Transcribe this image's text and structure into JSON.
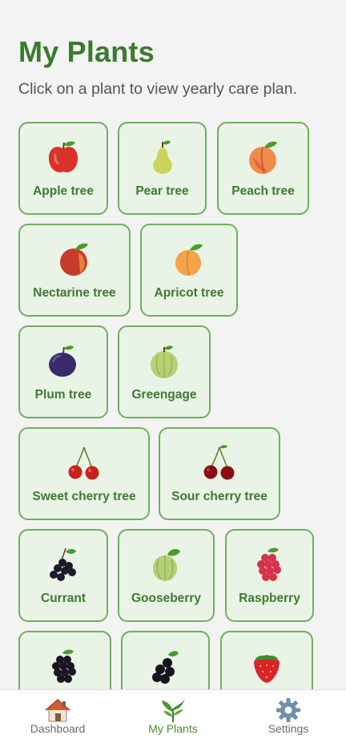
{
  "page": {
    "title": "My Plants",
    "subtitle": "Click on a plant to view yearly care plan."
  },
  "plants": [
    {
      "label": "Apple tree",
      "icon": "apple-icon"
    },
    {
      "label": "Pear tree",
      "icon": "pear-icon"
    },
    {
      "label": "Peach tree",
      "icon": "peach-icon"
    },
    {
      "label": "Nectarine tree",
      "icon": "nectarine-icon"
    },
    {
      "label": "Apricot tree",
      "icon": "apricot-icon"
    },
    {
      "label": "Plum tree",
      "icon": "plum-icon"
    },
    {
      "label": "Greengage",
      "icon": "greengage-icon"
    },
    {
      "label": "Sweet cherry tree",
      "icon": "sweet-cherry-icon"
    },
    {
      "label": "Sour cherry tree",
      "icon": "sour-cherry-icon"
    },
    {
      "label": "Currant",
      "icon": "currant-icon"
    },
    {
      "label": "Gooseberry",
      "icon": "gooseberry-icon"
    },
    {
      "label": "Raspberry",
      "icon": "raspberry-icon"
    },
    {
      "label": "",
      "icon": "blackberry-icon"
    },
    {
      "label": "",
      "icon": "black-currant-icon"
    },
    {
      "label": "",
      "icon": "strawberry-icon"
    }
  ],
  "nav": {
    "dashboard": "Dashboard",
    "my_plants": "My Plants",
    "settings": "Settings",
    "active": "My Plants"
  },
  "colors": {
    "title_green": "#3b7a2c",
    "tile_border": "#6fb05f",
    "tile_bg": "#e9f3e6",
    "active_nav": "#4b8f33"
  }
}
